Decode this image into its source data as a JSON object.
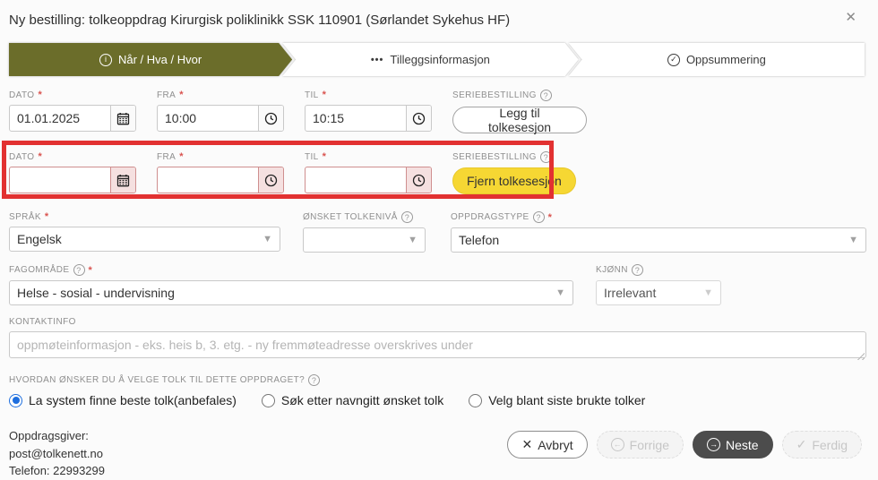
{
  "window": {
    "title": "Ny bestilling: tolkeoppdrag Kirurgisk poliklinikk SSK 110901 (Sørlandet Sykehus HF)",
    "close": "✕"
  },
  "steps": [
    {
      "label": "Når / Hva / Hvor",
      "icon": "info-circle",
      "active": true
    },
    {
      "label": "Tilleggsinformasjon",
      "icon": "ellipsis",
      "active": false
    },
    {
      "label": "Oppsummering",
      "icon": "check-circle",
      "active": false
    }
  ],
  "sessions": [
    {
      "date_label": "DATO",
      "date_value": "01.01.2025",
      "from_label": "FRA",
      "from_value": "10:00",
      "to_label": "TIL",
      "to_value": "10:15",
      "serie_label": "SERIEBESTILLING",
      "button_label": "Legg til tolkesesjon"
    },
    {
      "date_label": "DATO",
      "date_value": "",
      "from_label": "FRA",
      "from_value": "",
      "to_label": "TIL",
      "to_value": "",
      "serie_label": "SERIEBESTILLING",
      "button_label": "Fjern tolkesesjon"
    }
  ],
  "fields": {
    "sprak": {
      "label": "SPRÅK",
      "value": "Engelsk"
    },
    "tolkeniva": {
      "label": "ØNSKET TOLKENIVÅ",
      "value": ""
    },
    "oppdragstype": {
      "label": "OPPDRAGSTYPE",
      "value": "Telefon"
    },
    "fagomrade": {
      "label": "FAGOMRÅDE",
      "value": "Helse - sosial - undervisning"
    },
    "kjonn": {
      "label": "KJØNN",
      "value": "Irrelevant"
    },
    "kontaktinfo": {
      "label": "KONTAKTINFO",
      "placeholder": "oppmøteinformasjon - eks. heis b, 3. etg. - ny fremmøteadresse overskrives under"
    }
  },
  "tolk_choice": {
    "label": "HVORDAN ØNSKER DU Å VELGE TOLK TIL DETTE OPPDRAGET?",
    "options": [
      {
        "label": "La system finne beste tolk(anbefales)",
        "selected": true
      },
      {
        "label": "Søk etter navngitt ønsket tolk",
        "selected": false
      },
      {
        "label": "Velg blant siste brukte tolker",
        "selected": false
      }
    ]
  },
  "footer": {
    "info_lines": [
      "Oppdragsgiver:",
      "post@tolkenett.no",
      "Telefon: 22993299"
    ],
    "buttons": {
      "avbryt": "Avbryt",
      "forrige": "Forrige",
      "neste": "Neste",
      "ferdig": "Ferdig"
    }
  },
  "colors": {
    "step_active_bg": "#6b6d2a",
    "annotation_red": "#e23131",
    "remove_button_yellow": "#f6d733",
    "radio_blue": "#1e6ede",
    "primary_button_dark": "#4c4c4c",
    "error_border": "#cf8f8f",
    "error_icon_bg": "#f5e0e0"
  }
}
